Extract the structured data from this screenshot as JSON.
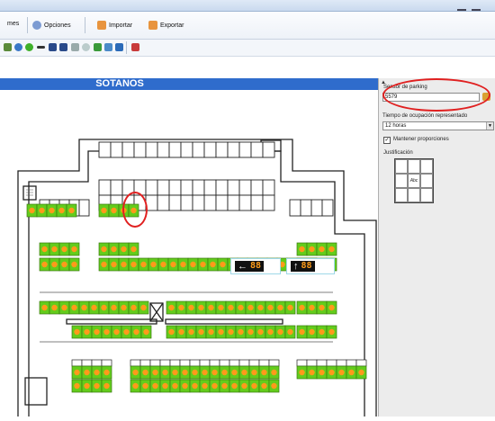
{
  "menubar": {
    "items": [
      {
        "label": "mes",
        "icon": "informes-icon",
        "color": "#6a8fcf"
      },
      {
        "label": "Opciones",
        "icon": "options-gear-icon",
        "color": "#5b7fbf"
      },
      {
        "label": "Importar",
        "icon": "import-icon",
        "color": "#e0802a"
      },
      {
        "label": "Exportar",
        "icon": "export-icon",
        "color": "#e0802a"
      }
    ]
  },
  "toolbar": {
    "tools": [
      "zoom-icon",
      "eye-icon",
      "green-sphere-icon",
      "line-icon",
      "grid-icon",
      "grid-alt-icon",
      "shape-icon",
      "cloud-icon",
      "add-icon",
      "map-icon",
      "view-icon",
      "tool-icon"
    ]
  },
  "map": {
    "title": "SOTANOS",
    "colors": {
      "spot": "#63cc1c",
      "dot": "#ff9a1a",
      "header": "#2f6ccc",
      "highlight": "#e02020"
    },
    "displays": [
      {
        "arrow": "←",
        "digits": "88"
      },
      {
        "arrow": "↑",
        "digits": "88"
      }
    ]
  },
  "panel": {
    "sensor_label": "Sensor de parking",
    "sensor_value": "5579",
    "tiempo_label": "Tiempo de ocupación representado",
    "tiempo_value": "12 horas",
    "mantener_label": "Mantener proporciones",
    "mantener_checked": "✓",
    "justificacion_label": "Justificación",
    "justificacion_sample": "Abc"
  }
}
